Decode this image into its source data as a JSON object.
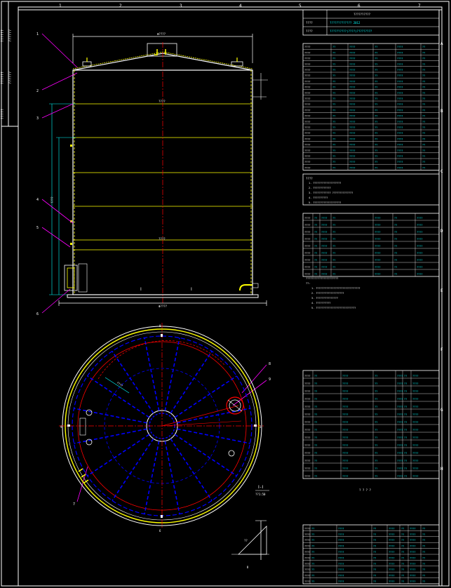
{
  "colors": {
    "background": "#000000",
    "frame": "#ffffff",
    "shell": "#ffff00",
    "centerline": "#ff0000",
    "dimension": "#00ffff",
    "leader": "#ff00ff",
    "structure": "#0000ff",
    "table_text": "#00ffff",
    "table_hl": "#ffff00"
  },
  "zone_numbers": [
    "1",
    "2",
    "3",
    "4",
    "5",
    "6",
    "7"
  ],
  "zone_letters": [
    "A",
    "B",
    "C",
    "D",
    "E",
    "F",
    "G",
    "H"
  ],
  "drawing": {
    "elevation_dims": {
      "overall_width": "Φ????",
      "base_width": "Φ????",
      "height_mid": "????",
      "height_left": "????"
    },
    "plan_label": "Ⅰ-Ⅰ",
    "detail_label": "Ⅱ"
  },
  "leader_numbers": [
    "1",
    "2",
    "3",
    "4",
    "5",
    "6",
    "7",
    "8",
    "9"
  ],
  "tables": {
    "notes_header": "????",
    "parts_header": "? ? ?",
    "components_header": "? ? ? ?",
    "bom_header": "? ? ?",
    "rows_design": 22,
    "rows_parts": 8,
    "rows_components": 13,
    "rows_bom": 9
  }
}
